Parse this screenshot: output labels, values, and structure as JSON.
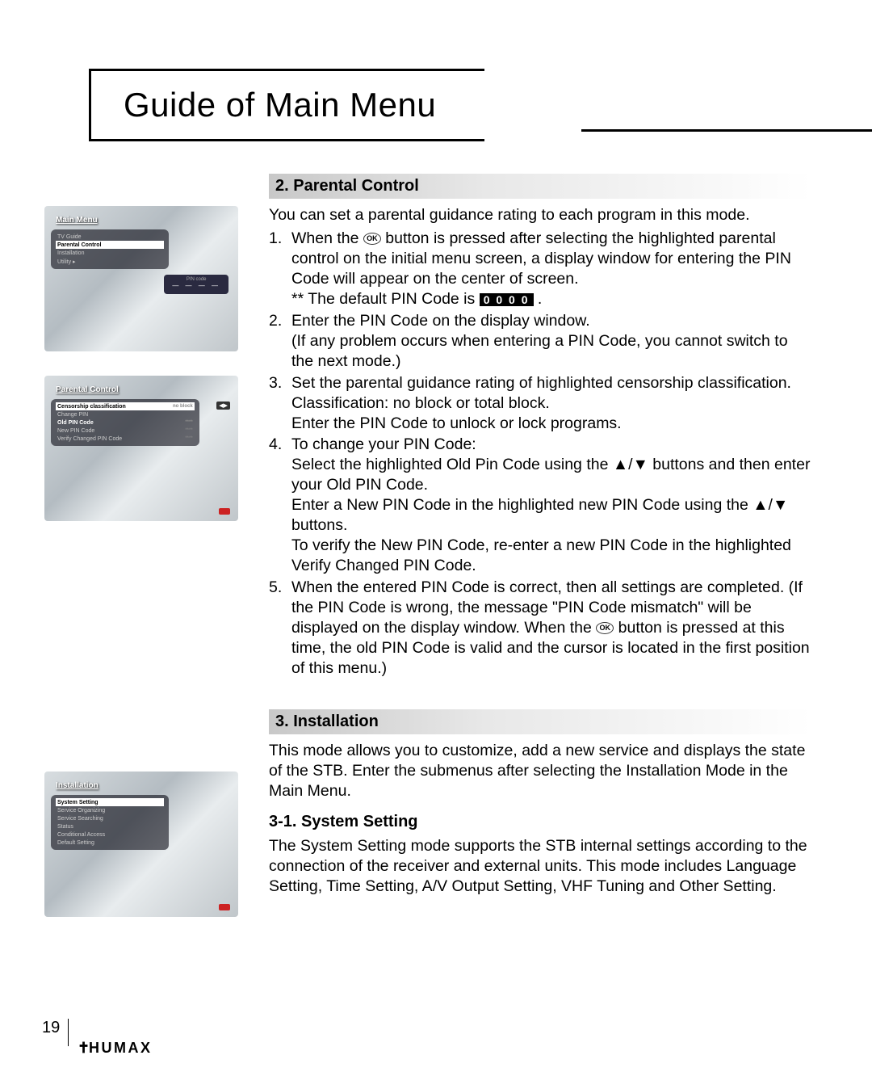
{
  "page_title": "Guide of Main Menu",
  "page_number": "19",
  "brand": "HUMAX",
  "icons": {
    "ok": "OK",
    "arrows": "▲/▼"
  },
  "pin_default": "0 0 0 0",
  "screenshots": {
    "s1": {
      "title": "Main Menu",
      "items": [
        "TV Guide",
        "Parental Control",
        "Installation",
        "Utility"
      ],
      "highlight_index": 1,
      "pin_label": "PIN code",
      "pin_dots": "— — — —"
    },
    "s2": {
      "title": "Parental Control",
      "rows": [
        {
          "label": "Censorship classification",
          "val": "no block",
          "hl": true
        },
        {
          "label": "Change PIN",
          "val": ""
        },
        {
          "label": "Old PIN Code",
          "val": "****",
          "bold": true
        },
        {
          "label": "New PIN Code",
          "val": "****"
        },
        {
          "label": "Verify Changed PIN Code",
          "val": "****"
        }
      ]
    },
    "s3": {
      "title": "Installation",
      "items": [
        "System Setting",
        "Service Organizing",
        "Service Searching",
        "Status",
        "Conditional Access",
        "Default Setting"
      ],
      "highlight_index": 0
    }
  },
  "section1": {
    "heading": "2. Parental Control",
    "intro": "You can set a parental guidance rating to each program in this mode.",
    "items": [
      {
        "num": "1.",
        "lines": [
          "When the {OK} button is pressed after selecting the highlighted parental control on the initial menu screen, a display window for entering the PIN Code will appear on the center of screen.",
          "** The default PIN Code is {PIN} ."
        ]
      },
      {
        "num": "2.",
        "lines": [
          "Enter the PIN Code on the display window.",
          "(If any problem occurs when entering a PIN Code, you cannot switch to the next mode.)"
        ]
      },
      {
        "num": "3.",
        "lines": [
          "Set the parental guidance rating of highlighted censorship classification.",
          "Classification: no block or total block.",
          "Enter the PIN Code to unlock or lock programs."
        ]
      },
      {
        "num": "4.",
        "lines": [
          "To change your PIN Code:",
          "Select the highlighted Old Pin Code using the  {ARR} buttons and then enter your Old PIN Code.",
          "Enter a New PIN Code in the highlighted new PIN Code using the  {ARR} buttons.",
          "To verify the New PIN Code, re-enter a new PIN Code in the highlighted Verify Changed PIN Code."
        ]
      },
      {
        "num": "5.",
        "lines": [
          "When the entered PIN Code is correct, then all settings are completed. (If the PIN Code is wrong, the message \"PIN Code mismatch\" will be displayed on the display window. When the {OK} button is pressed at this time, the old PIN Code is valid and the cursor is located in the first position of this menu.)"
        ]
      }
    ]
  },
  "section2": {
    "heading": "3. Installation",
    "intro": "This mode allows you to customize, add a new service and displays the state of the STB. Enter the submenus after selecting the Installation Mode in the Main Menu.",
    "sub_heading": "3-1. System Setting",
    "sub_body": "The System Setting mode supports the STB internal settings according to the connection of the receiver and external units. This mode includes Language Setting, Time Setting, A/V Output Setting, VHF Tuning and Other Setting."
  }
}
